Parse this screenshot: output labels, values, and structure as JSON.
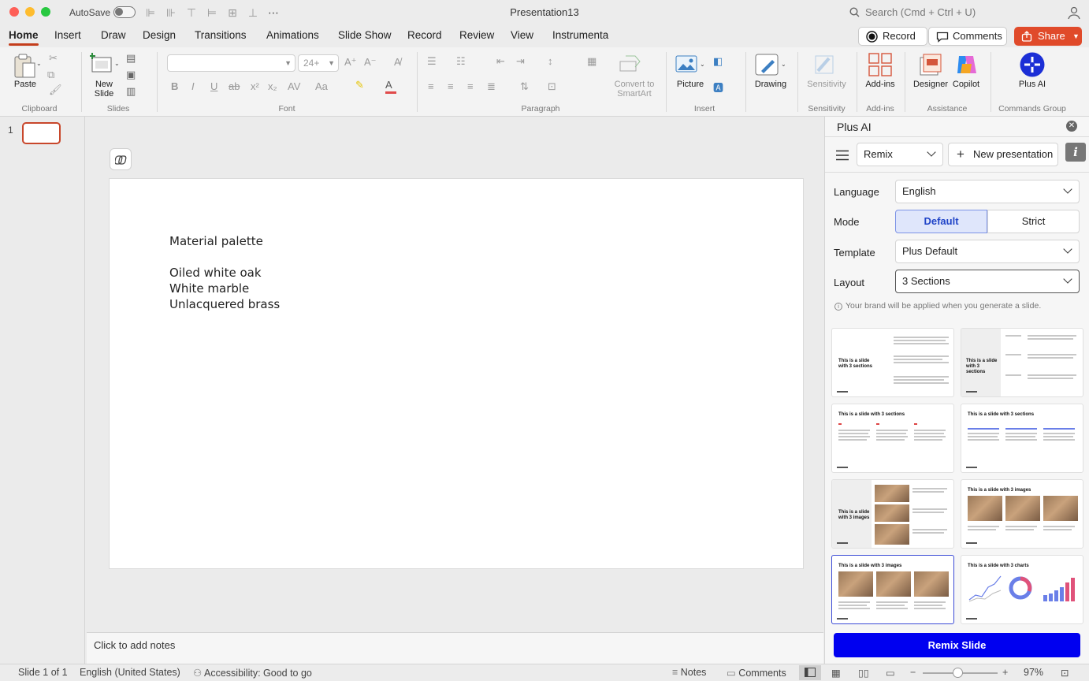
{
  "window": {
    "title": "Presentation13",
    "autosave_label": "AutoSave",
    "search_placeholder": "Search (Cmd + Ctrl + U)"
  },
  "menu": {
    "tabs": [
      "Home",
      "Insert",
      "Draw",
      "Design",
      "Transitions",
      "Animations",
      "Slide Show",
      "Record",
      "Review",
      "View",
      "Instrumenta"
    ],
    "record_label": "Record",
    "comments_label": "Comments",
    "share_label": "Share"
  },
  "ribbon": {
    "paste": "Paste",
    "new_slide": "New Slide",
    "font_size": "24+",
    "convert_smartart": "Convert to SmartArt",
    "picture": "Picture",
    "drawing": "Drawing",
    "sensitivity": "Sensitivity",
    "addins": "Add-ins",
    "designer": "Designer",
    "copilot": "Copilot",
    "plus_ai": "Plus AI",
    "groups": {
      "clipboard": "Clipboard",
      "slides": "Slides",
      "font": "Font",
      "paragraph": "Paragraph",
      "insert": "Insert",
      "sensitivity": "Sensitivity",
      "addins": "Add-ins",
      "assistance": "Assistance",
      "commands": "Commands Group"
    }
  },
  "thumbnails": {
    "number": "1"
  },
  "slide": {
    "lines": [
      "Material palette",
      "",
      "Oiled white oak",
      "White marble",
      "Unlacquered brass"
    ]
  },
  "notes": {
    "placeholder": "Click to add notes"
  },
  "status": {
    "slide_count": "Slide 1 of 1",
    "language": "English (United States)",
    "accessibility": "Accessibility: Good to go",
    "notes": "Notes",
    "comments": "Comments",
    "zoom": "97%"
  },
  "panel": {
    "title": "Plus AI",
    "mode_dropdown": "Remix",
    "new_presentation": "New presentation",
    "language_label": "Language",
    "language_value": "English",
    "mode_label": "Mode",
    "mode_default": "Default",
    "mode_strict": "Strict",
    "template_label": "Template",
    "template_value": "Plus Default",
    "layout_label": "Layout",
    "layout_value": "3 Sections",
    "brand_note": "Your brand will be applied when you generate a slide.",
    "cards": [
      {
        "title": "This is a slide with 3 sections"
      },
      {
        "title": "This is a slide with 3 sections"
      },
      {
        "title": "This is a slide with 3 sections"
      },
      {
        "title": "This is a slide with 3 sections"
      },
      {
        "title": "This is a slide with 3 images"
      },
      {
        "title": "This is a slide with 3 images"
      },
      {
        "title": "This is a slide with 3 images"
      },
      {
        "title": "This is a slide with 3 charts"
      }
    ],
    "remix_button": "Remix Slide"
  },
  "colors": {
    "accent": "#c43e1c",
    "share": "#e04a2a",
    "remix": "#0000f0"
  }
}
